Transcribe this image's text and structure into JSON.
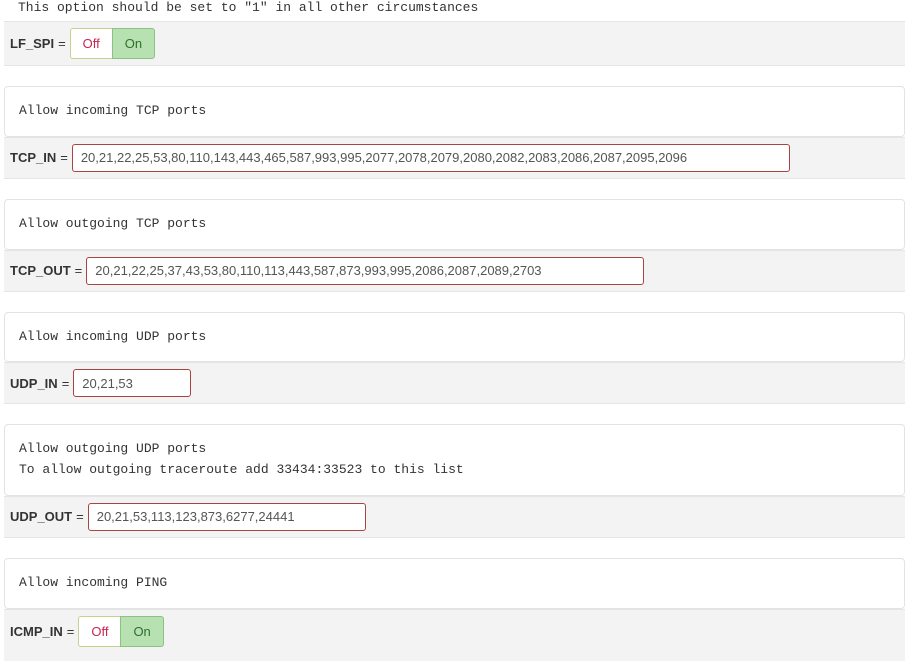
{
  "truncated_line": "This option should be set to \"1\" in all other circumstances",
  "toggle": {
    "off": "Off",
    "on": "On"
  },
  "settings": {
    "lf_spi": {
      "label": "LF_SPI",
      "eq": "="
    },
    "tcp_in": {
      "desc": "Allow incoming TCP ports",
      "label": "TCP_IN",
      "eq": "=",
      "value": "20,21,22,25,53,80,110,143,443,465,587,993,995,2077,2078,2079,2080,2082,2083,2086,2087,2095,2096"
    },
    "tcp_out": {
      "desc": "Allow outgoing TCP ports",
      "label": "TCP_OUT",
      "eq": "=",
      "value": "20,21,22,25,37,43,53,80,110,113,443,587,873,993,995,2086,2087,2089,2703"
    },
    "udp_in": {
      "desc": "Allow incoming UDP ports",
      "label": "UDP_IN",
      "eq": "=",
      "value": "20,21,53"
    },
    "udp_out": {
      "desc": "Allow outgoing UDP ports\nTo allow outgoing traceroute add 33434:33523 to this list",
      "label": "UDP_OUT",
      "eq": "=",
      "value": "20,21,53,113,123,873,6277,24441"
    },
    "icmp_in": {
      "desc": "Allow incoming PING",
      "label": "ICMP_IN",
      "eq": "="
    }
  }
}
